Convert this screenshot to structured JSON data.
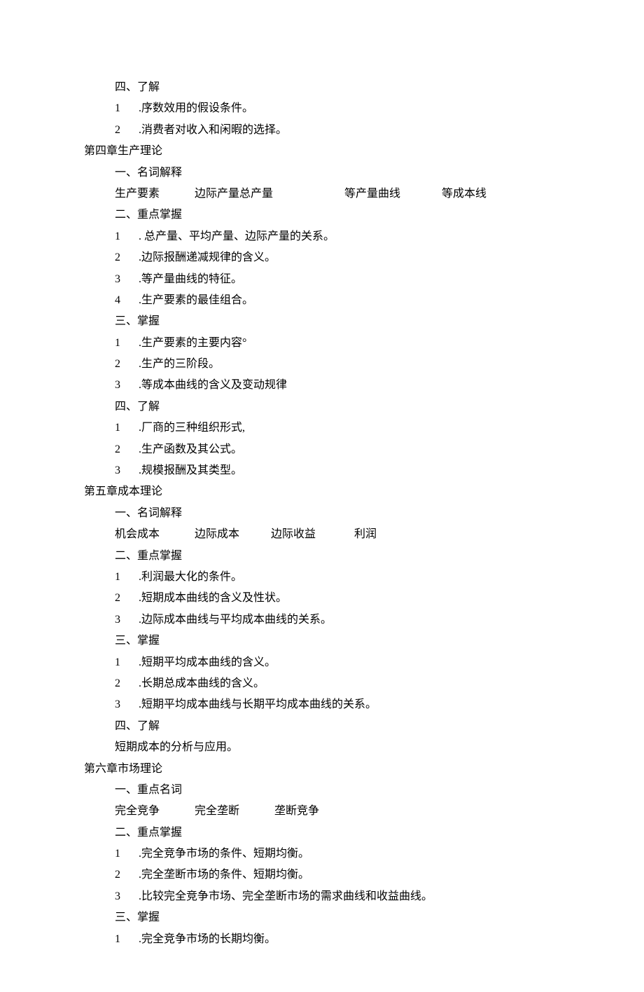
{
  "sections": {
    "ch3_tail": {
      "s4_heading": "四、了解",
      "s4_item1_num": "1",
      "s4_item1_text": " .序数效用的假设条件。",
      "s4_item2_num": "2",
      "s4_item2_text": " .消费者对收入和闲暇的选择。"
    },
    "ch4": {
      "title": "第四章生产理论",
      "s1_heading": "一、名词解释",
      "s1_terms_1": "生产要素",
      "s1_terms_2": "边际产量总产量",
      "s1_terms_3": "等产量曲线",
      "s1_terms_4": "等成本线",
      "s2_heading": "二、重点掌握",
      "s2_item1_num": "1",
      "s2_item1_text": " . 总产量、平均产量、边际产量的关系。",
      "s2_item2_num": "2",
      "s2_item2_text": " .边际报酬递减规律的含义。",
      "s2_item3_num": "3",
      "s2_item3_text": " .等产量曲线的特征。",
      "s2_item4_num": "4",
      "s2_item4_text": " .生产要素的最佳组合。",
      "s3_heading": "三、掌握",
      "s3_item1_num": "1",
      "s3_item1_text": " .生产要素的主要内容°",
      "s3_item2_num": "2",
      "s3_item2_text": " .生产的三阶段。",
      "s3_item3_num": "3",
      "s3_item3_text": " .等成本曲线的含义及变动规律",
      "s4_heading": "四、了解",
      "s4_item1_num": "1",
      "s4_item1_text": " .厂商的三种组织形式,",
      "s4_item2_num": "2",
      "s4_item2_text": " .生产函数及其公式。",
      "s4_item3_num": "3",
      "s4_item3_text": " .规模报酬及其类型。"
    },
    "ch5": {
      "title": "第五章成本理论",
      "s1_heading": "一、名词解释",
      "s1_terms_1": "机会成本",
      "s1_terms_2": "边际成本",
      "s1_terms_3": "边际收益",
      "s1_terms_4": "利润",
      "s2_heading": "二、重点掌握",
      "s2_item1_num": "1",
      "s2_item1_text": " .利润最大化的条件。",
      "s2_item2_num": "2",
      "s2_item2_text": " .短期成本曲线的含义及性状。",
      "s2_item3_num": "3",
      "s2_item3_text": " .边际成本曲线与平均成本曲线的关系。",
      "s3_heading": "三、掌握",
      "s3_item1_num": "1",
      "s3_item1_text": " .短期平均成本曲线的含义。",
      "s3_item2_num": "2",
      "s3_item2_text": " .长期总成本曲线的含义。",
      "s3_item3_num": "3",
      "s3_item3_text": " .短期平均成本曲线与长期平均成本曲线的关系。",
      "s4_heading": "四、了解",
      "s4_text": "短期成本的分析与应用。"
    },
    "ch6": {
      "title": "第六章市场理论",
      "s1_heading": "一、重点名词",
      "s1_terms_1": "完全竞争",
      "s1_terms_2": "完全垄断",
      "s1_terms_3": "垄断竞争",
      "s2_heading": "二、重点掌握",
      "s2_item1_num": "1",
      "s2_item1_text": " .完全竞争市场的条件、短期均衡。",
      "s2_item2_num": "2",
      "s2_item2_text": " .完全垄断市场的条件、短期均衡。",
      "s2_item3_num": "3",
      "s2_item3_text": " .比较完全竞争市场、完全垄断市场的需求曲线和收益曲线。",
      "s3_heading": "三、掌握",
      "s3_item1_num": "1",
      "s3_item1_text": " .完全竞争市场的长期均衡。"
    }
  }
}
